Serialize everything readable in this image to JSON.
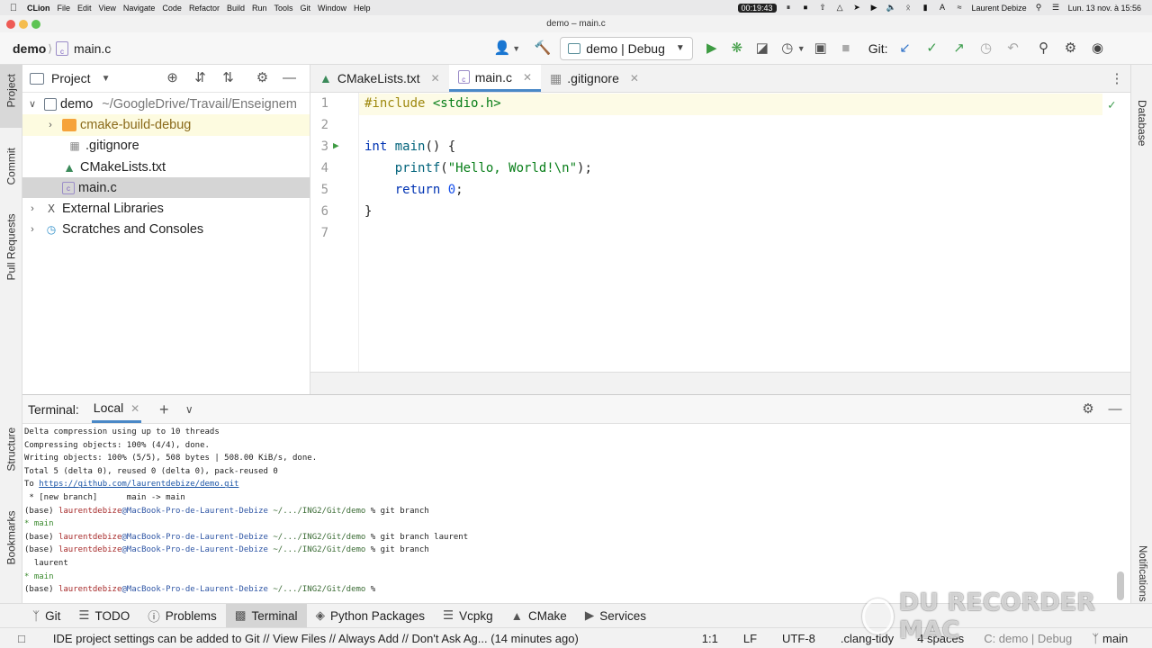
{
  "menubar": {
    "app": "CLion",
    "items": [
      "File",
      "Edit",
      "View",
      "Navigate",
      "Code",
      "Refactor",
      "Build",
      "Run",
      "Tools",
      "Git",
      "Window",
      "Help"
    ],
    "recording_time": "00:19:43",
    "user": "Laurent Debize",
    "datetime": "Lun. 13 nov. à 15:56"
  },
  "window": {
    "title": "demo – main.c"
  },
  "toolbar": {
    "project": "demo",
    "file": "main.c",
    "run_config": "demo | Debug",
    "git_label": "Git:"
  },
  "left_strip": {
    "project": "Project",
    "commit": "Commit",
    "pull_requests": "Pull Requests",
    "structure": "Structure",
    "bookmarks": "Bookmarks"
  },
  "right_strip": {
    "database": "Database",
    "notifications": "Notifications"
  },
  "project_panel": {
    "title": "Project",
    "tree": [
      {
        "name": "demo",
        "path": "~/GoogleDrive/Travail/Enseignem"
      },
      {
        "name": "cmake-build-debug"
      },
      {
        "name": ".gitignore"
      },
      {
        "name": "CMakeLists.txt"
      },
      {
        "name": "main.c"
      },
      {
        "name": "External Libraries"
      },
      {
        "name": "Scratches and Consoles"
      }
    ]
  },
  "editor": {
    "tabs": [
      {
        "label": "CMakeLists.txt"
      },
      {
        "label": "main.c"
      },
      {
        "label": ".gitignore"
      }
    ],
    "line_numbers": [
      "1",
      "2",
      "3",
      "4",
      "5",
      "6",
      "7"
    ],
    "code": {
      "l1_kw": "#include",
      "l1_rest": " <stdio.h>",
      "l3_kw": "int",
      "l3_fn": "main",
      "l3_rest": "() {",
      "l4_fn": "printf",
      "l4_open": "(",
      "l4_str": "\"Hello, World!\\n\"",
      "l4_close": ");",
      "l5_kw": "return",
      "l5_num": "0",
      "l5_semi": ";",
      "l6": "}"
    }
  },
  "terminal": {
    "title": "Terminal:",
    "tab": "Local",
    "lines": {
      "l1": "Delta compression using up to 10 threads",
      "l2": "Compressing objects: 100% (4/4), done.",
      "l3": "Writing objects: 100% (5/5), 508 bytes | 508.00 KiB/s, done.",
      "l4": "Total 5 (delta 0), reused 0 (delta 0), pack-reused 0",
      "l5_to": "To ",
      "l5_url": "https://github.com/laurentdebize/demo.git",
      "l6": " * [new branch]      main -> main",
      "base": "(base) ",
      "user": "laurentdebize",
      "host": "@MacBook-Pro-de-Laurent-Debize",
      "path": " ~/.../ING2/Git/demo",
      "cmd1": " % git branch",
      "cmd2": " % git branch laurent",
      "cmd3": " % git branch",
      "cmd4": " %",
      "star_main": "* main",
      "laurent": "  laurent"
    }
  },
  "bottom_tools": [
    {
      "label": "Git"
    },
    {
      "label": "TODO"
    },
    {
      "label": "Problems"
    },
    {
      "label": "Terminal"
    },
    {
      "label": "Python Packages"
    },
    {
      "label": "Vcpkg"
    },
    {
      "label": "CMake"
    },
    {
      "label": "Services"
    }
  ],
  "statusbar": {
    "message": "IDE project settings can be added to Git // View Files // Always Add // Don't Ask Ag... (14 minutes ago)",
    "position": "1:1",
    "line_sep": "LF",
    "encoding": "UTF-8",
    "linter": ".clang-tidy",
    "indent": "4 spaces",
    "context": "C: demo | Debug",
    "branch": "main"
  },
  "watermark": "DU RECORDER MAC"
}
